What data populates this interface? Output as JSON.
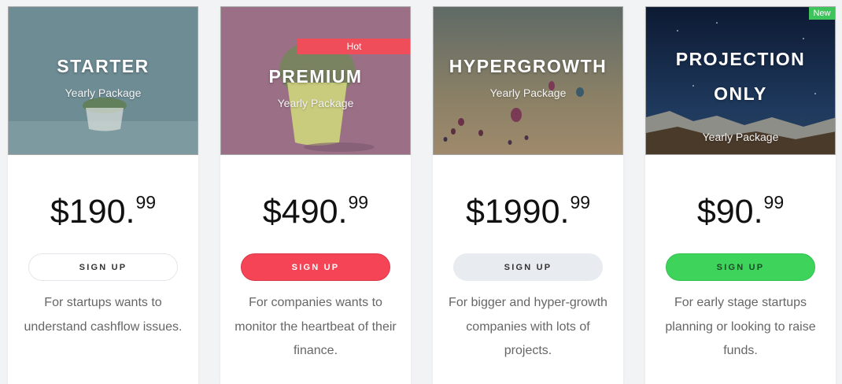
{
  "plans": [
    {
      "name": "STARTER",
      "subtitle": "Yearly Package",
      "price_main": "$190.",
      "price_cents": "99",
      "button_label": "SIGN UP",
      "description": "For startups wants to understand cashflow issues.",
      "button_color": "#ffffff"
    },
    {
      "name": "PREMIUM",
      "subtitle": "Yearly Package",
      "badge": "Hot",
      "price_main": "$490.",
      "price_cents": "99",
      "button_label": "SIGN UP",
      "description": "For companies wants to monitor the heartbeat of their finance.",
      "button_color": "#f44455"
    },
    {
      "name": "HYPERGROWTH",
      "subtitle": "Yearly Package",
      "price_main": "$1990.",
      "price_cents": "99",
      "button_label": "SIGN UP",
      "description": "For bigger and hyper-growth companies with lots of projects.",
      "button_color": "#e8ebf0"
    },
    {
      "name": "PROJECTION ONLY",
      "subtitle": "Yearly Package",
      "badge": "New",
      "price_main": "$90.",
      "price_cents": "99",
      "button_label": "SIGN UP",
      "description": "For early stage startups planning or looking to raise funds.",
      "button_color": "#3ed45c"
    }
  ]
}
